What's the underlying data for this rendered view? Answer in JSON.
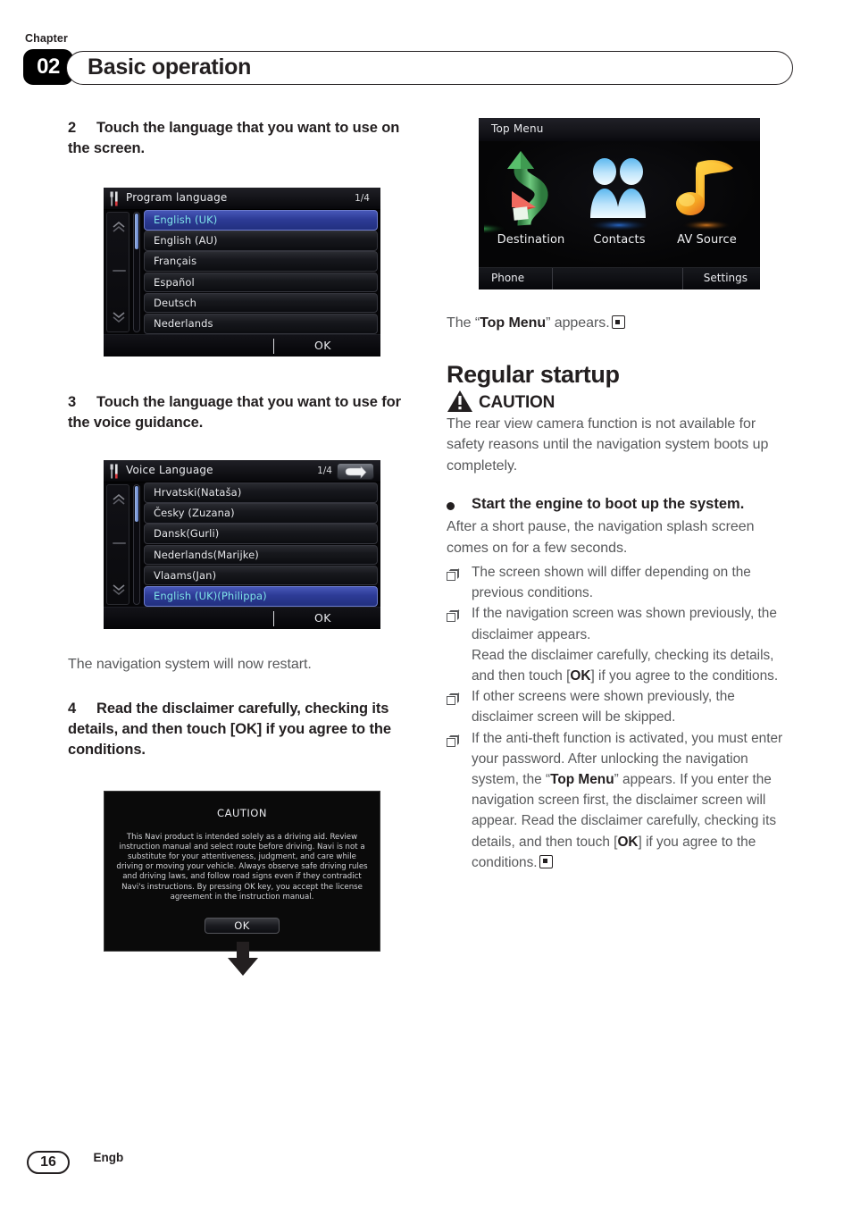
{
  "header": {
    "chapter_word": "Chapter",
    "chapter_number": "02",
    "title": "Basic operation"
  },
  "left_column": {
    "step2": {
      "number": "2",
      "text": "Touch the language that you want to use on the screen."
    },
    "program_language_screen": {
      "title": "Program language",
      "page_index": "1/4",
      "title_icon": "tool-settings-icon",
      "items": [
        {
          "label": "English (UK)",
          "selected": true
        },
        {
          "label": "English (AU)",
          "selected": false
        },
        {
          "label": "Français",
          "selected": false
        },
        {
          "label": "Español",
          "selected": false
        },
        {
          "label": "Deutsch",
          "selected": false
        },
        {
          "label": "Nederlands",
          "selected": false
        }
      ],
      "ok_label": "OK"
    },
    "step3": {
      "number": "3",
      "text": "Touch the language that you want to use for the voice guidance."
    },
    "voice_language_screen": {
      "title": "Voice Language",
      "page_index": "1/4",
      "title_icon": "tool-settings-icon",
      "back_icon": "back-arrow-icon",
      "items": [
        {
          "label": "Hrvatski(Nataša)",
          "selected": false
        },
        {
          "label": "Česky (Zuzana)",
          "selected": false
        },
        {
          "label": "Dansk(Gurli)",
          "selected": false
        },
        {
          "label": "Nederlands(Marijke)",
          "selected": false
        },
        {
          "label": "Vlaams(Jan)",
          "selected": false
        },
        {
          "label": "English (UK)(Philippa)",
          "selected": true
        }
      ],
      "ok_label": "OK"
    },
    "restart_note": "The navigation system will now restart.",
    "step4": {
      "number": "4",
      "text": "Read the disclaimer carefully, checking its details, and then touch [OK] if you agree to the conditions."
    },
    "caution_screen": {
      "title": "CAUTION",
      "body": "This Navi product is intended solely as a driving aid. Review instruction manual and select route before driving. Navi is not a substitute for your attentiveness, judgment, and care while driving or moving your vehicle.  Always observe safe driving rules and driving laws, and follow road signs even if they contradict Navi's instructions.  By pressing OK key, you accept the license agreement in the instruction manual.",
      "ok_label": "OK"
    },
    "flow_arrow_icon": "down-arrow-icon"
  },
  "right_column": {
    "top_menu_screen": {
      "title": "Top Menu",
      "items": [
        {
          "label": "Destination",
          "icon": "green-route-arrow-icon",
          "accent": "#3faa5a"
        },
        {
          "label": "Contacts",
          "icon": "two-people-icon",
          "accent": "#2a6fd6"
        },
        {
          "label": "AV Source",
          "icon": "music-note-icon",
          "accent": "#f0a71e"
        }
      ],
      "footer_left": "Phone",
      "footer_right": "Settings"
    },
    "top_menu_caption_pre": "The “",
    "top_menu_caption_bold": "Top Menu",
    "top_menu_caption_post": "” appears.",
    "section_title": "Regular startup",
    "caution": {
      "icon": "warning-triangle-icon",
      "label": "CAUTION",
      "text": "The rear view camera function is not available for safety reasons until the navigation system boots up completely."
    },
    "bullet": {
      "heading": "Start the engine to boot up the system.",
      "text": "After a short pause, the navigation splash screen comes on for a few seconds."
    },
    "notes": [
      {
        "segments": [
          {
            "t": "The screen shown will differ depending on the previous conditions.",
            "b": false
          }
        ]
      },
      {
        "segments": [
          {
            "t": "If the navigation screen was shown previously, the disclaimer appears.\nRead the disclaimer carefully, checking its details, and then touch [",
            "b": false
          },
          {
            "t": "OK",
            "b": true
          },
          {
            "t": "] if you agree to the conditions.",
            "b": false
          }
        ]
      },
      {
        "segments": [
          {
            "t": "If other screens were shown previously, the disclaimer screen will be skipped.",
            "b": false
          }
        ]
      },
      {
        "segments": [
          {
            "t": "If the anti-theft function is activated, you must enter your password. After unlocking the navigation system, the “",
            "b": false
          },
          {
            "t": "Top Menu",
            "b": true
          },
          {
            "t": "” appears. If you enter the navigation screen first, the disclaimer screen will appear. Read the disclaimer carefully, checking its details, and then touch [",
            "b": false
          },
          {
            "t": "OK",
            "b": true
          },
          {
            "t": "] if you agree to the conditions.",
            "b": false
          },
          {
            "t": "@END@",
            "b": false
          }
        ]
      }
    ]
  },
  "footer": {
    "page_number": "16",
    "language_code": "Engb"
  },
  "colors": {
    "ink": "#231f20",
    "body_gray": "#58595b",
    "selected_blue": "#2d3b96",
    "selected_text": "#7fe3e8"
  }
}
